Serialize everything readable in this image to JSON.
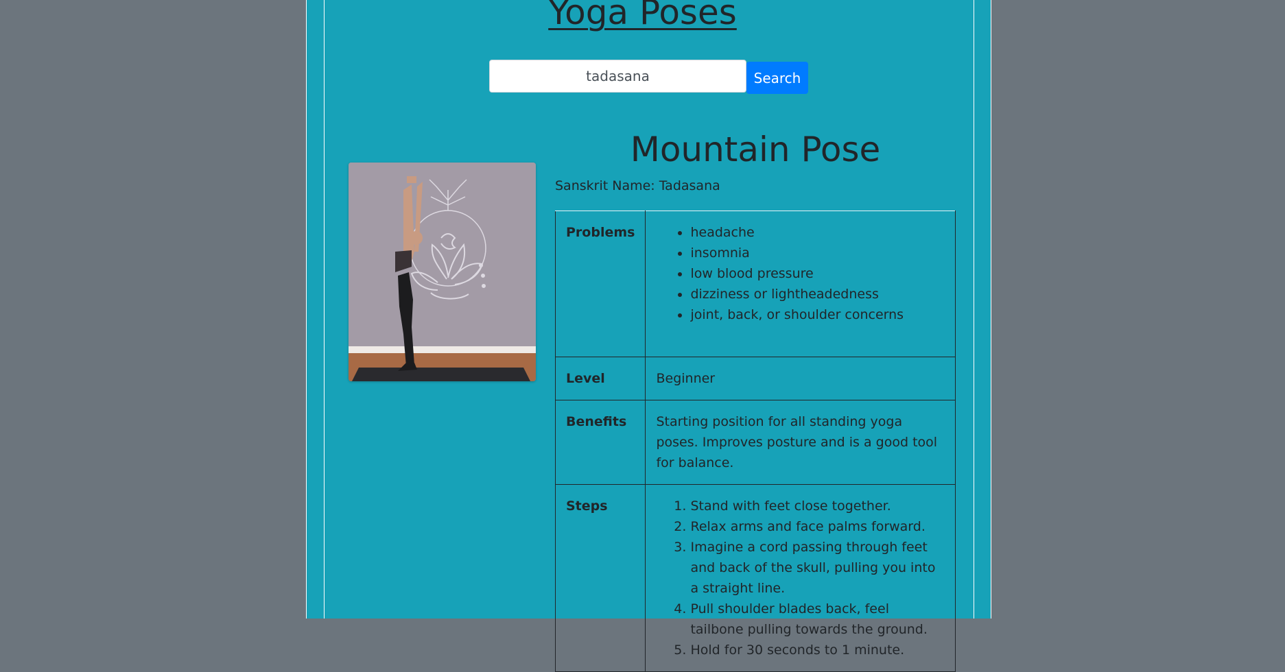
{
  "page_title": "Yoga Poses",
  "search": {
    "value": "tadasana",
    "button_label": "Search"
  },
  "pose": {
    "name": "Mountain Pose",
    "sanskrit_line": "Sanskrit Name: Tadasana",
    "image_icon": "yoga-pose-photo",
    "labels": {
      "problems": "Problems",
      "level": "Level",
      "benefits": "Benefits",
      "steps": "Steps"
    },
    "problems": [
      "headache",
      "insomnia",
      "low blood pressure",
      "dizziness or lightheadedness",
      "joint, back, or shoulder concerns"
    ],
    "level": "Beginner",
    "benefits": "Starting position for all standing yoga poses. Improves posture and is a good tool for balance.",
    "steps": [
      "Stand with feet close together.",
      "Relax arms and face palms forward.",
      "Imagine a cord passing through feet and back of the skull, pulling you into a straight line.",
      "Pull shoulder blades back, feel tailbone pulling towards the ground.",
      "Hold for 30 seconds to 1 minute."
    ]
  },
  "colors": {
    "page_background": "#6c757d",
    "panel_background": "#17a2b8",
    "button_primary": "#007bff",
    "text": "#212529"
  }
}
